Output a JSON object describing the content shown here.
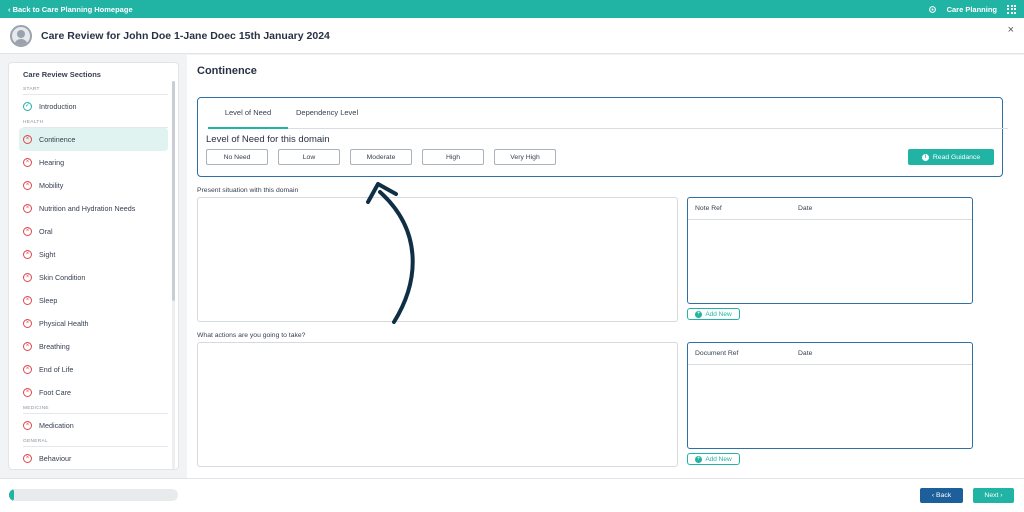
{
  "topbar": {
    "back_link": "‹ Back to Care Planning Homepage",
    "app_name": "Care Planning"
  },
  "header": {
    "title": "Care Review for John Doe 1-Jane Doec 15th January 2024",
    "close": "×"
  },
  "sidebar": {
    "title": "Care Review Sections",
    "groups": [
      {
        "label": "START",
        "items": [
          {
            "label": "Introduction",
            "status": "complete"
          }
        ]
      },
      {
        "label": "HEALTH",
        "items": [
          {
            "label": "Continence",
            "status": "incomplete",
            "active": true
          },
          {
            "label": "Hearing",
            "status": "incomplete"
          },
          {
            "label": "Mobility",
            "status": "incomplete"
          },
          {
            "label": "Nutrition and Hydration Needs",
            "status": "incomplete"
          },
          {
            "label": "Oral",
            "status": "incomplete"
          },
          {
            "label": "Sight",
            "status": "incomplete"
          },
          {
            "label": "Skin Condition",
            "status": "incomplete"
          },
          {
            "label": "Sleep",
            "status": "incomplete"
          },
          {
            "label": "Physical Health",
            "status": "incomplete"
          },
          {
            "label": "Breathing",
            "status": "incomplete"
          },
          {
            "label": "End of Life",
            "status": "incomplete"
          },
          {
            "label": "Foot Care",
            "status": "incomplete"
          }
        ]
      },
      {
        "label": "MEDICINE",
        "items": [
          {
            "label": "Medication",
            "status": "incomplete"
          }
        ]
      },
      {
        "label": "GENERAL",
        "items": [
          {
            "label": "Behaviour",
            "status": "incomplete"
          }
        ]
      }
    ]
  },
  "main": {
    "section_title": "Continence",
    "tabs": [
      {
        "label": "Level of Need"
      },
      {
        "label": "Dependency Level"
      }
    ],
    "need_label": "Level of Need for this domain",
    "levels": [
      "No Need",
      "Low",
      "Moderate",
      "High",
      "Very High"
    ],
    "guidance_label": "Read Guidance",
    "situation_label": "Present situation with this domain",
    "actions_label": "What actions are you going to take?",
    "notes_table": {
      "col1": "Note Ref",
      "col2": "Date"
    },
    "docs_table": {
      "col1": "Document Ref",
      "col2": "Date"
    },
    "add_new": "Add New"
  },
  "footer": {
    "back": "‹ Back",
    "next": "Next ›",
    "progress": 0.03
  },
  "colors": {
    "accent": "#21b3a4",
    "primary_dark": "#1d5f9a",
    "error": "#e0474c",
    "border_blue": "#2e6fa6"
  },
  "icons": {
    "settings": "gear-icon",
    "apps": "grid-icon",
    "status_ok": "check-circle-icon",
    "status_bad": "x-circle-icon"
  }
}
